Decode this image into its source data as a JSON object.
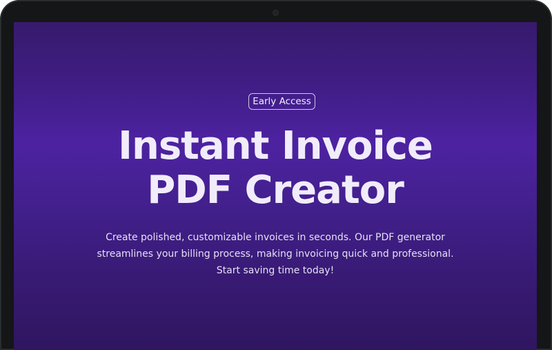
{
  "hero": {
    "badge": "Early Access",
    "title_line1": "Instant Invoice",
    "title_line2": "PDF Creator",
    "description": "Create polished, customizable invoices in seconds. Our PDF generator streamlines your billing process, making invoicing quick and professional. Start saving time today!"
  },
  "colors": {
    "device_frame": "#141617",
    "screen_top": "#371a6c",
    "screen_mid": "#4d22a1",
    "screen_bottom": "#2f165f",
    "text": "#f1ecfa"
  },
  "icons": {
    "camera": "webcam-dot"
  }
}
